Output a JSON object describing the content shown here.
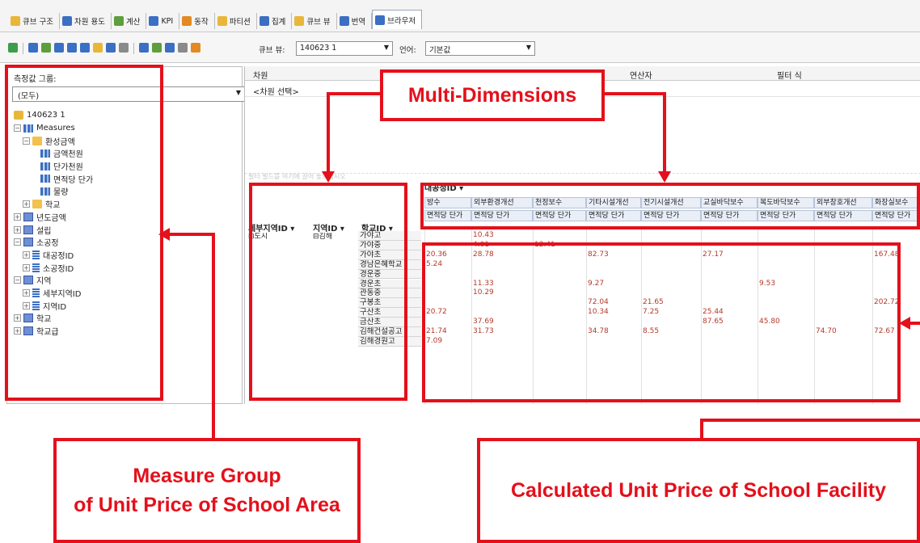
{
  "tabs": [
    {
      "label": "큐브 구조",
      "color": "#e8b73a"
    },
    {
      "label": "차원 용도",
      "color": "#3b6fc3"
    },
    {
      "label": "계산",
      "color": "#5e9e3d"
    },
    {
      "label": "KPI",
      "color": "#3b6fc3"
    },
    {
      "label": "동작",
      "color": "#e38a22"
    },
    {
      "label": "파티션",
      "color": "#e8b73a"
    },
    {
      "label": "집계",
      "color": "#3b6fc3"
    },
    {
      "label": "큐브 뷰",
      "color": "#e8b73a"
    },
    {
      "label": "번역",
      "color": "#3b6fc3"
    },
    {
      "label": "브라우저",
      "color": "#3b6fc3"
    }
  ],
  "active_tab": "브라우저",
  "toolbar": {
    "cube_label": "큐브 뷰:",
    "cube_value": "140623 1",
    "language_label": "언어:",
    "language_value": "기본값"
  },
  "measure_panel": {
    "label": "측정값 그룹:",
    "selected": "(모두)"
  },
  "tree": [
    {
      "label": "140623 1",
      "icon": "cube-icon",
      "indent": 0,
      "expander": ""
    },
    {
      "label": "Measures",
      "icon": "measures-icon",
      "indent": 0,
      "expander": "⊟"
    },
    {
      "label": "환성금액",
      "icon": "folder-icon",
      "indent": 1,
      "expander": "⊟"
    },
    {
      "label": "금액천원",
      "icon": "measure-icon",
      "indent": 3,
      "expander": ""
    },
    {
      "label": "단가천원",
      "icon": "measure-icon",
      "indent": 3,
      "expander": ""
    },
    {
      "label": "면적당 단가",
      "icon": "calculated-measure-icon",
      "indent": 3,
      "expander": ""
    },
    {
      "label": "물량",
      "icon": "measure-icon",
      "indent": 3,
      "expander": ""
    },
    {
      "label": "학교",
      "icon": "folder-icon",
      "indent": 1,
      "expander": "⊞"
    },
    {
      "label": "년도금액",
      "icon": "dimension-icon",
      "indent": 0,
      "expander": "⊞"
    },
    {
      "label": "설립",
      "icon": "dimension-icon",
      "indent": 0,
      "expander": "⊞"
    },
    {
      "label": "소공정",
      "icon": "dimension-icon",
      "indent": 0,
      "expander": "⊟"
    },
    {
      "label": "대공정ID",
      "icon": "attribute-icon",
      "indent": 1,
      "expander": "⊞"
    },
    {
      "label": "소공정ID",
      "icon": "attribute-icon",
      "indent": 1,
      "expander": "⊞"
    },
    {
      "label": "지역",
      "icon": "dimension-icon",
      "indent": 0,
      "expander": "⊟"
    },
    {
      "label": "세부지역ID",
      "icon": "attribute-icon",
      "indent": 1,
      "expander": "⊞"
    },
    {
      "label": "지역ID",
      "icon": "attribute-icon",
      "indent": 1,
      "expander": "⊞"
    },
    {
      "label": "학교",
      "icon": "dimension-icon",
      "indent": 0,
      "expander": "⊞"
    },
    {
      "label": "학교급",
      "icon": "dimension-icon",
      "indent": 0,
      "expander": "⊞"
    }
  ],
  "filter": {
    "col_dimension": "차원",
    "col_operator": "연산자",
    "col_expression": "필터 식",
    "select_dimension": "<차원 선택>",
    "drop_hint": "필터 필드를 여기에 끌어 놓으십시오"
  },
  "pivot": {
    "column_dimension": "대공정ID",
    "row_dimensions": [
      "세부지역ID",
      "지역ID",
      "학교ID"
    ],
    "measures": [
      "방수",
      "외부환경개선",
      "천정보수",
      "기타시설개선",
      "전기시설개선",
      "교실바닥보수",
      "복도바닥보수",
      "외부창호개선",
      "화장실보수"
    ],
    "unit_header": "면적당 단가",
    "region_detail": "도시",
    "region": "김해",
    "schools": [
      "가야고",
      "가야중",
      "가야초",
      "경남은혜학교",
      "경운중",
      "경운초",
      "관동중",
      "구봉초",
      "구산초",
      "금산초",
      "김해건설공고",
      "김해경원고"
    ],
    "values": [
      [
        "",
        "10.43",
        "",
        "",
        "",
        "",
        "",
        "",
        ""
      ],
      [
        "",
        "4.01",
        "12.41",
        "",
        "",
        "",
        "",
        "",
        ""
      ],
      [
        "20.36",
        "28.78",
        "",
        "82.73",
        "",
        "27.17",
        "",
        "",
        "167.48"
      ],
      [
        "5.24",
        "",
        "",
        "",
        "",
        "",
        "",
        "",
        ""
      ],
      [
        "",
        "",
        "",
        "",
        "",
        "",
        "",
        "",
        ""
      ],
      [
        "",
        "11.33",
        "",
        "9.27",
        "",
        "",
        "9.53",
        "",
        ""
      ],
      [
        "",
        "10.29",
        "",
        "",
        "",
        "",
        "",
        "",
        ""
      ],
      [
        "",
        "",
        "",
        "72.04",
        "21.65",
        "",
        "",
        "",
        "202.72"
      ],
      [
        "20.72",
        "",
        "",
        "10.34",
        "7.25",
        "25.44",
        "",
        "",
        ""
      ],
      [
        "",
        "37.69",
        "",
        "",
        "",
        "87.65",
        "45.80",
        "",
        ""
      ],
      [
        "21.74",
        "31.73",
        "",
        "34.78",
        "8.55",
        "",
        "",
        "74.70",
        "72.67"
      ],
      [
        "7.09",
        "",
        "",
        "",
        "",
        "",
        "",
        "",
        ""
      ]
    ]
  },
  "annotations": {
    "multi_dimensions": "Multi-Dimensions",
    "measure_group_line1": "Measure Group",
    "measure_group_line2": "of Unit Price of School Area",
    "calculated": "Calculated Unit Price of School Facility"
  },
  "colors": {
    "annotation_red": "#e4101b",
    "cell_value": "#b33a2a"
  }
}
